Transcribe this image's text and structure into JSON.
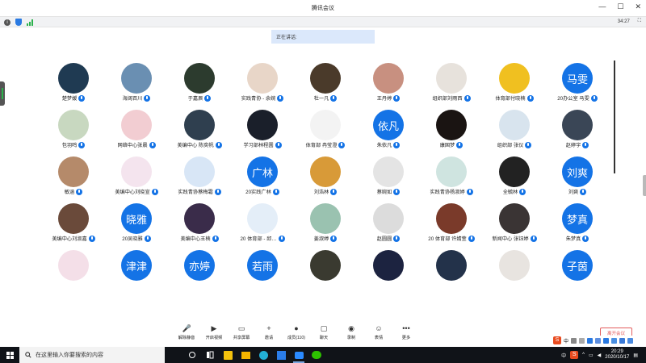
{
  "window": {
    "title": "腾讯会议",
    "minimize": "—",
    "maximize": "☐",
    "close": "✕"
  },
  "status": {
    "time": "34:27",
    "expand": "⛶"
  },
  "speaking": {
    "label": "正在讲话:"
  },
  "participants": [
    {
      "name": "楚梦嫒",
      "avatar": "#1f3a52"
    },
    {
      "name": "海阔百川",
      "avatar": "#6a8fb2"
    },
    {
      "name": "于嘉辰",
      "avatar": "#2c3b2e"
    },
    {
      "name": "实践青协 - 余婉",
      "avatar": "#e8d6c8"
    },
    {
      "name": "杜一凡",
      "avatar": "#4a3a2a"
    },
    {
      "name": "王丹婷",
      "avatar": "#c89080"
    },
    {
      "name": "组织部刘雨西",
      "avatar": "#e7e2dc"
    },
    {
      "name": "体育部付晓楠",
      "avatar": "#f0c020"
    },
    {
      "name": "20办公室 马雯",
      "text": "马雯"
    },
    {
      "name": "包羽鸣",
      "avatar": "#c8d8c0"
    },
    {
      "name": "网络中心张晨",
      "avatar": "#f2cdd2"
    },
    {
      "name": "美编中心 陈奕帆",
      "avatar": "#2f3f4f"
    },
    {
      "name": "学习部林程圆",
      "avatar": "#1a1f2a"
    },
    {
      "name": "体育部 冉莹澄",
      "avatar": "#f3f3f3"
    },
    {
      "name": "朱依凡",
      "text": "依凡"
    },
    {
      "name": "康国梦",
      "avatar": "#1a1412"
    },
    {
      "name": "组织部 张仪",
      "avatar": "#d8e4ee"
    },
    {
      "name": "赵婷宇",
      "avatar": "#3a4656"
    },
    {
      "name": "敏涵",
      "avatar": "#b58a6a"
    },
    {
      "name": "美编中心刘晓宣",
      "avatar": "#f4e4ee"
    },
    {
      "name": "实践青协蔡梅霜",
      "avatar": "#d8e6f6"
    },
    {
      "name": "20实践广林",
      "text": "广林"
    },
    {
      "name": "刘浩林",
      "avatar": "#d89a38"
    },
    {
      "name": "蔡婉如",
      "avatar": "#e4e4e4"
    },
    {
      "name": "实践青协杨淑婷",
      "avatar": "#cfe4e0"
    },
    {
      "name": "全毓林",
      "avatar": "#222222"
    },
    {
      "name": "刘爽",
      "text": "刘爽"
    },
    {
      "name": "美编中心刘淑嘉",
      "avatar": "#6a4a3a"
    },
    {
      "name": "20吴晓雅",
      "text": "晓雅"
    },
    {
      "name": "美编中心王楠",
      "avatar": "#3a2c4a"
    },
    {
      "name": "20 体育部 - 邱…",
      "avatar": "#e4eef8"
    },
    {
      "name": "姜淑婷",
      "avatar": "#9ac2b0"
    },
    {
      "name": "赵圆圆",
      "avatar": "#dcdcdc"
    },
    {
      "name": "20 体育部 许婧萱",
      "avatar": "#7a3a2a"
    },
    {
      "name": "新闻中心 张钰婷",
      "avatar": "#3a3434"
    },
    {
      "name": "朱梦真",
      "text": "梦真"
    },
    {
      "name": "",
      "avatar": "#f4dfe8"
    },
    {
      "name": "",
      "text": "津津"
    },
    {
      "name": "",
      "text": "亦婷"
    },
    {
      "name": "",
      "text": "若雨"
    },
    {
      "name": "",
      "avatar": "#3a3a30"
    },
    {
      "name": "",
      "avatar": "#1c2340"
    },
    {
      "name": "",
      "avatar": "#23324a"
    },
    {
      "name": "",
      "avatar": "#e8e4e0"
    },
    {
      "name": "",
      "text": "子茵"
    }
  ],
  "toolbar": {
    "items": [
      {
        "label": "解除静音",
        "icon": "mic-muted-icon",
        "glyph": "🎤"
      },
      {
        "label": "开启视频",
        "icon": "video-off-icon",
        "glyph": "▶"
      },
      {
        "label": "共享屏幕",
        "icon": "share-screen-icon",
        "glyph": "▭"
      },
      {
        "label": "邀请",
        "icon": "invite-icon",
        "glyph": "+"
      },
      {
        "label": "成员(110)",
        "icon": "members-icon",
        "glyph": "●"
      },
      {
        "label": "聊天",
        "icon": "chat-icon",
        "glyph": "▢"
      },
      {
        "label": "录制",
        "icon": "record-icon",
        "glyph": "◉"
      },
      {
        "label": "表情",
        "icon": "emoji-icon",
        "glyph": "☺"
      },
      {
        "label": "更多",
        "icon": "more-icon",
        "glyph": "•••"
      }
    ],
    "end": "离开会议"
  },
  "ime": {
    "s": "S",
    "mode": "中"
  },
  "taskbar": {
    "search_placeholder": "在这里输入你要搜索的内容",
    "tray_lang": "中",
    "time": "20:29",
    "date": "2020/10/17",
    "tray_s": "S"
  },
  "colors": {
    "accent": "#1473e6",
    "danger": "#e35d5d",
    "taskbar": "#101318"
  }
}
